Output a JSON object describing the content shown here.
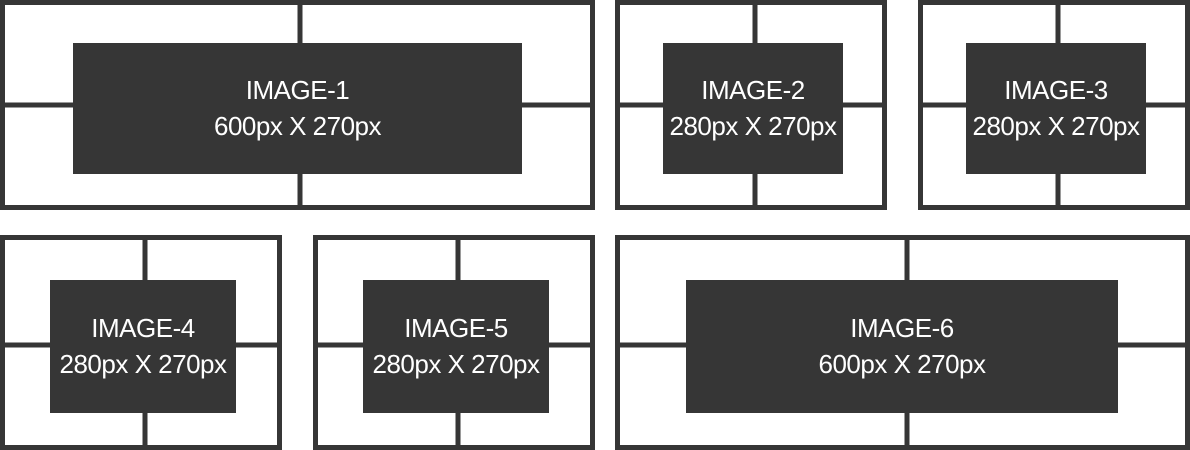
{
  "colors": {
    "frame": "#363636",
    "box": "#363636",
    "text": "#ffffff",
    "background": "#ffffff"
  },
  "tiles": [
    {
      "title": "IMAGE-1",
      "size": "600px X 270px"
    },
    {
      "title": "IMAGE-2",
      "size": "280px X 270px"
    },
    {
      "title": "IMAGE-3",
      "size": "280px X 270px"
    },
    {
      "title": "IMAGE-4",
      "size": "280px X 270px"
    },
    {
      "title": "IMAGE-5",
      "size": "280px X 270px"
    },
    {
      "title": "IMAGE-6",
      "size": "600px X 270px"
    }
  ]
}
